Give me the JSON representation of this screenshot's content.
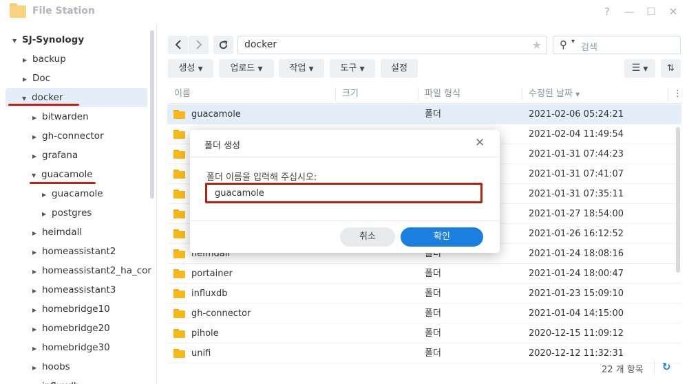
{
  "window": {
    "title": "File Station",
    "controls": [
      "?",
      "—",
      "☐",
      "✕"
    ]
  },
  "sidebar": {
    "root": "SJ-Synology",
    "items": [
      {
        "label": "backup"
      },
      {
        "label": "Doc"
      },
      {
        "label": "docker"
      },
      {
        "label": "bitwarden"
      },
      {
        "label": "gh-connector"
      },
      {
        "label": "grafana"
      },
      {
        "label": "guacamole"
      },
      {
        "label": "guacamole"
      },
      {
        "label": "postgres"
      },
      {
        "label": "heimdall"
      },
      {
        "label": "homeassistant2"
      },
      {
        "label": "homeassistant2_ha_cor"
      },
      {
        "label": "homeassistant3"
      },
      {
        "label": "homebridge10"
      },
      {
        "label": "homebridge20"
      },
      {
        "label": "homebridge30"
      },
      {
        "label": "hoobs"
      },
      {
        "label": "influxdb"
      }
    ]
  },
  "toolbar": {
    "path": "docker",
    "search_placeholder": "검색",
    "buttons": [
      "생성",
      "업로드",
      "작업",
      "도구",
      "설정"
    ]
  },
  "table": {
    "headers": [
      "이름",
      "크기",
      "파일 형식",
      "수정된 날짜"
    ],
    "rows": [
      {
        "name": "guacamole",
        "type": "폴더",
        "date": "2021-02-06 05:24:21"
      },
      {
        "name": "",
        "type": "",
        "date": "2021-02-04 11:49:54"
      },
      {
        "name": "",
        "type": "",
        "date": "2021-01-31 07:44:23"
      },
      {
        "name": "",
        "type": "",
        "date": "2021-01-31 07:41:07"
      },
      {
        "name": "",
        "type": "",
        "date": "2021-01-31 07:35:11"
      },
      {
        "name": "",
        "type": "",
        "date": "2021-01-27 18:54:00"
      },
      {
        "name": "",
        "type": "",
        "date": "2021-01-26 16:12:52"
      },
      {
        "name": "heimdall",
        "type": "폴더",
        "date": "2021-01-24 18:08:16"
      },
      {
        "name": "portainer",
        "type": "폴더",
        "date": "2021-01-24 18:00:47"
      },
      {
        "name": "influxdb",
        "type": "폴더",
        "date": "2021-01-23 15:09:10"
      },
      {
        "name": "gh-connector",
        "type": "폴더",
        "date": "2021-01-04 14:15:00"
      },
      {
        "name": "pihole",
        "type": "폴더",
        "date": "2020-12-15 11:09:12"
      },
      {
        "name": "unifi",
        "type": "폴더",
        "date": "2020-12-12 11:32:31"
      }
    ]
  },
  "status": {
    "count": "22 개 항목"
  },
  "dialog": {
    "title": "폴더 생성",
    "label": "폴더 이름을 입력해 주십시오:",
    "value": "guacamole",
    "cancel": "취소",
    "ok": "확인"
  },
  "colors": {
    "accent": "#1b7fe0",
    "highlight": "#b3220f",
    "selected": "#e3eef9"
  }
}
